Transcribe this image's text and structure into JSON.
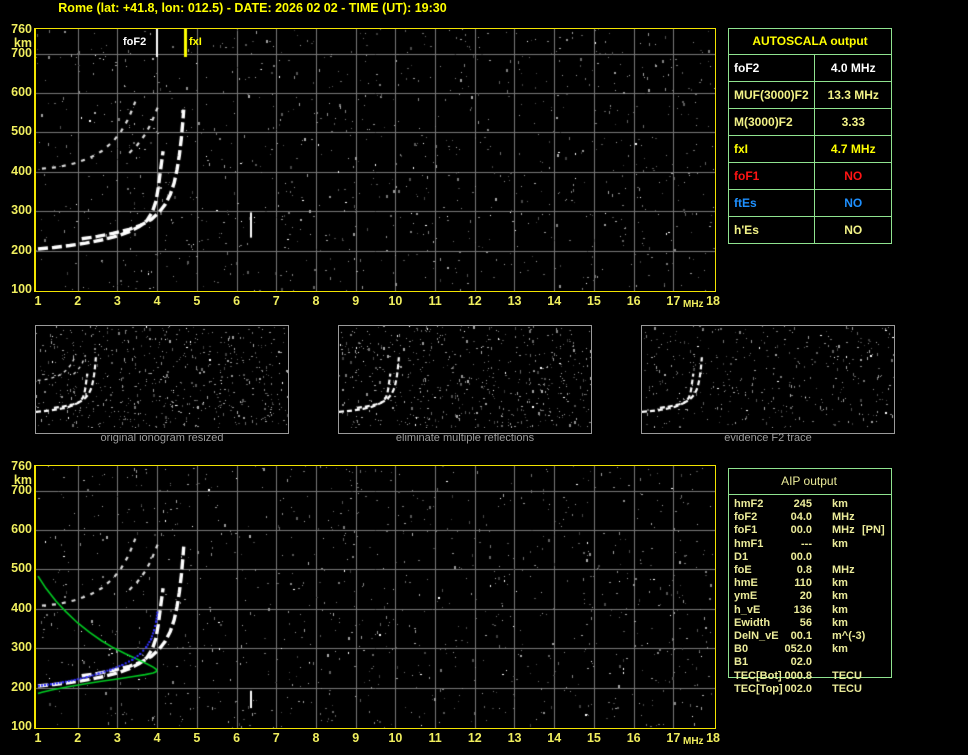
{
  "window_title": "Rome (lat: +41.8, lon: 012.5) - DATE: 2026 02 02 - TIME (UT): 19:30",
  "colors": {
    "background": "#000000",
    "title_yellow": "#ffff00",
    "axis_label": "#f0ee5e",
    "plot_border": "#f2e400",
    "grid": "#787878",
    "table_border_green": "#8fe28f",
    "pale_yellow_text": "#ecec9a",
    "khaki_value": "#f2f287",
    "red": "#ff1414",
    "blue": "#1e90ff",
    "trace_white": "#ffffff",
    "profile_green": "#00cc22",
    "restored_trace_blue": "#3232ff",
    "thumb_caption_gray": "#9c9c9c"
  },
  "top_markers": {
    "foF2_label": "foF2",
    "fxI_label": "fxI"
  },
  "autoscala": {
    "title": "AUTOSCALA output",
    "rows": [
      {
        "label": "foF2",
        "value": "4.0 MHz",
        "color": "#ffffff"
      },
      {
        "label": "MUF(3000)F2",
        "value": "13.3 MHz",
        "color": "#f2f287"
      },
      {
        "label": "M(3000)F2",
        "value": "3.33",
        "color": "#f2f287"
      },
      {
        "label": "fxI",
        "value": "4.7 MHz",
        "color": "#ffff00"
      },
      {
        "label": "foF1",
        "value": "NO",
        "color": "#ff1414"
      },
      {
        "label": "ftEs",
        "value": "NO",
        "color": "#1e90ff"
      },
      {
        "label": "h'Es",
        "value": "NO",
        "color": "#f2f287"
      }
    ]
  },
  "aip": {
    "title": "AIP output",
    "rows": [
      {
        "label": "hmF2",
        "value": "245",
        "unit": "km",
        "note": ""
      },
      {
        "label": "foF2",
        "value": "04.0",
        "unit": "MHz",
        "note": ""
      },
      {
        "label": "foF1",
        "value": "00.0",
        "unit": "MHz",
        "note": "[PN]"
      },
      {
        "label": "hmF1",
        "value": "---",
        "unit": "km",
        "note": ""
      },
      {
        "label": "D1",
        "value": "00.0",
        "unit": "",
        "note": ""
      },
      {
        "label": "foE",
        "value": "0.8",
        "unit": "MHz",
        "note": ""
      },
      {
        "label": "hmE",
        "value": "110",
        "unit": "km",
        "note": ""
      },
      {
        "label": "ymE",
        "value": "20",
        "unit": "km",
        "note": ""
      },
      {
        "label": "h_vE",
        "value": "136",
        "unit": "km",
        "note": ""
      },
      {
        "label": "Ewidth",
        "value": "56",
        "unit": "km",
        "note": ""
      },
      {
        "label": "DelN_vE",
        "value": "00.1",
        "unit": "m^(-3)",
        "note": ""
      },
      {
        "label": "B0",
        "value": "052.0",
        "unit": "km",
        "note": ""
      },
      {
        "label": "B1",
        "value": "02.0",
        "unit": "",
        "note": ""
      },
      {
        "label": "TEC[Bot]",
        "value": "000.8",
        "unit": "TECU",
        "note": ""
      },
      {
        "label": "TEC[Top]",
        "value": "002.0",
        "unit": "TECU",
        "note": ""
      }
    ]
  },
  "thumbnails": [
    {
      "caption": "original ionogram resized"
    },
    {
      "caption": "eliminate multiple reflections"
    },
    {
      "caption": "evidence F2 trace"
    }
  ],
  "chart_data": [
    {
      "id": "top-ionogram",
      "type": "scatter",
      "xlabel": "MHz",
      "ylabel": "km",
      "xlim": [
        1,
        18
      ],
      "ylim": [
        100,
        760
      ],
      "grid": true,
      "x_ticks": [
        1,
        2,
        3,
        4,
        5,
        6,
        7,
        8,
        9,
        10,
        11,
        12,
        13,
        14,
        15,
        16,
        17,
        18
      ],
      "y_ticks": [
        760,
        700,
        600,
        500,
        400,
        300,
        200,
        100
      ],
      "markers": [
        {
          "name": "foF2",
          "f_mhz": 4.0,
          "color": "#ffffff"
        },
        {
          "name": "fxI",
          "f_mhz": 4.7,
          "color": "#ffff00"
        }
      ],
      "rfi_streaks": [
        {
          "f_mhz": 6.33,
          "km_range": [
            233,
            297
          ]
        }
      ],
      "noise": {
        "seed": 11,
        "count": 1000,
        "white_count": 45
      },
      "series": [
        {
          "name": "F2-O-trace",
          "color": "#ffffff",
          "points": [
            [
              1.0,
              204
            ],
            [
              1.4,
              208
            ],
            [
              1.8,
              213
            ],
            [
              2.2,
              219
            ],
            [
              2.6,
              227
            ],
            [
              3.0,
              237
            ],
            [
              3.3,
              248
            ],
            [
              3.55,
              261
            ],
            [
              3.75,
              277
            ],
            [
              3.88,
              298
            ],
            [
              3.97,
              325
            ],
            [
              4.03,
              360
            ],
            [
              4.08,
              400
            ],
            [
              4.12,
              430
            ],
            [
              4.15,
              452
            ]
          ]
        },
        {
          "name": "F2-X-trace",
          "color": "#ffffff",
          "points": [
            [
              2.1,
              230
            ],
            [
              2.5,
              236
            ],
            [
              2.9,
              244
            ],
            [
              3.3,
              254
            ],
            [
              3.6,
              265
            ],
            [
              3.85,
              279
            ],
            [
              4.05,
              297
            ],
            [
              4.2,
              317
            ],
            [
              4.33,
              342
            ],
            [
              4.43,
              372
            ],
            [
              4.5,
              405
            ],
            [
              4.56,
              442
            ],
            [
              4.61,
              485
            ],
            [
              4.65,
              530
            ],
            [
              4.67,
              558
            ]
          ]
        },
        {
          "name": "second-hop-O-trace",
          "color": "#dcdcdc",
          "points": [
            [
              1.1,
              408
            ],
            [
              1.5,
              412
            ],
            [
              1.9,
              421
            ],
            [
              2.3,
              435
            ],
            [
              2.6,
              452
            ],
            [
              2.9,
              478
            ],
            [
              3.1,
              504
            ],
            [
              3.25,
              530
            ],
            [
              3.37,
              557
            ],
            [
              3.45,
              578
            ]
          ]
        },
        {
          "name": "second-hop-X-trace",
          "color": "#dcdcdc",
          "points": [
            [
              3.3,
              448
            ],
            [
              3.5,
              468
            ],
            [
              3.7,
              495
            ],
            [
              3.85,
              523
            ],
            [
              3.95,
              548
            ],
            [
              4.02,
              565
            ]
          ]
        }
      ]
    },
    {
      "id": "bottom-ionogram",
      "type": "scatter",
      "xlabel": "MHz",
      "ylabel": "km",
      "xlim": [
        1,
        18
      ],
      "ylim": [
        100,
        760
      ],
      "grid": true,
      "x_ticks": [
        1,
        2,
        3,
        4,
        5,
        6,
        7,
        8,
        9,
        10,
        11,
        12,
        13,
        14,
        15,
        16,
        17,
        18
      ],
      "y_ticks": [
        760,
        700,
        600,
        500,
        400,
        300,
        200,
        100
      ],
      "series_from": "top-ionogram",
      "rfi_streaks": [
        {
          "f_mhz": 6.33,
          "km_range": [
            148,
            192
          ]
        }
      ],
      "noise": {
        "seed": 77,
        "count": 1000,
        "white_count": 45
      },
      "extra_series": [
        {
          "name": "electron-density-profile",
          "color": "#00cc22",
          "style": "line",
          "points": [
            [
              1.0,
              483
            ],
            [
              1.2,
              452
            ],
            [
              1.45,
              420
            ],
            [
              1.7,
              393
            ],
            [
              2.0,
              364
            ],
            [
              2.3,
              340
            ],
            [
              2.6,
              319
            ],
            [
              2.9,
              301
            ],
            [
              3.2,
              286
            ],
            [
              3.5,
              272
            ],
            [
              3.75,
              260
            ],
            [
              3.9,
              252
            ],
            [
              3.97,
              247
            ],
            [
              3.99,
              244
            ],
            [
              3.97,
              240
            ],
            [
              3.9,
              237
            ],
            [
              3.7,
              233
            ],
            [
              3.4,
              228
            ],
            [
              3.0,
              222
            ],
            [
              2.6,
              216
            ],
            [
              2.2,
              210
            ],
            [
              1.8,
              203
            ],
            [
              1.4,
              195
            ],
            [
              1.1,
              188
            ],
            [
              1.0,
              185
            ]
          ]
        },
        {
          "name": "restored-O-trace",
          "color": "#3232ff",
          "style": "dots",
          "points": [
            [
              1.0,
              207
            ],
            [
              1.3,
              211
            ],
            [
              1.6,
              216
            ],
            [
              1.9,
              222
            ],
            [
              2.2,
              229
            ],
            [
              2.5,
              238
            ],
            [
              2.8,
              248
            ],
            [
              3.1,
              260
            ],
            [
              3.35,
              273
            ],
            [
              3.55,
              288
            ],
            [
              3.7,
              305
            ],
            [
              3.82,
              325
            ],
            [
              3.9,
              348
            ],
            [
              3.95,
              370
            ],
            [
              3.98,
              393
            ]
          ]
        }
      ]
    },
    {
      "id": "thumb-original",
      "type": "scatter",
      "series_from": "top-ionogram",
      "include_multiples": true,
      "noise": {
        "seed": 21,
        "count": 620,
        "white_count": 22
      }
    },
    {
      "id": "thumb-eliminate",
      "type": "scatter",
      "series_from": "top-ionogram",
      "include_multiples": false,
      "noise": {
        "seed": 35,
        "count": 600,
        "white_count": 20
      }
    },
    {
      "id": "thumb-evidence",
      "type": "scatter",
      "series_from": "top-ionogram",
      "include_multiples": false,
      "noise": {
        "seed": 53,
        "count": 400,
        "white_count": 14
      }
    }
  ]
}
